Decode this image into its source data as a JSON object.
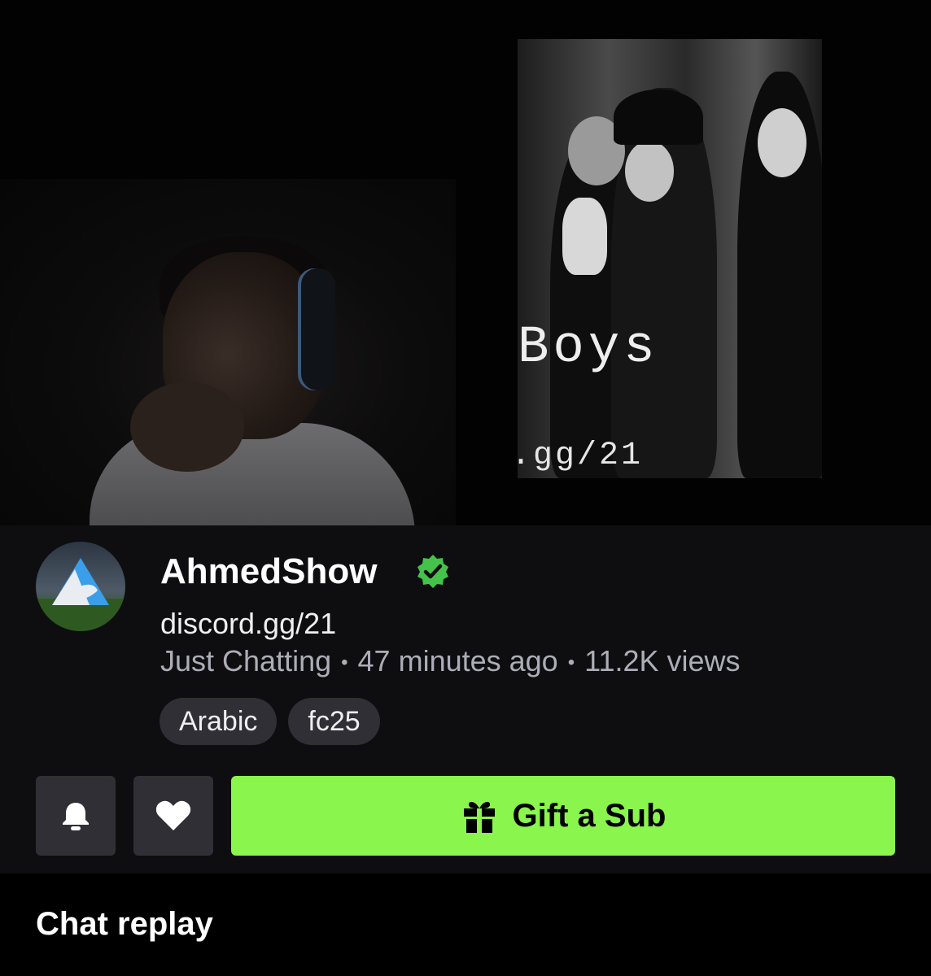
{
  "video": {
    "overlay_title": "Boys",
    "overlay_link": ".gg/21"
  },
  "channel": {
    "name": "AhmedShow",
    "verified_icon": "verified-badge-icon",
    "stream_title": "discord.gg/21",
    "category": "Just Chatting",
    "time_ago": "47 minutes ago",
    "views": "11.2K views",
    "separator": "•",
    "tags": [
      "Arabic",
      "fc25"
    ]
  },
  "actions": {
    "bell_icon": "bell-icon",
    "heart_icon": "heart-icon",
    "gift_label": "Gift a Sub",
    "gift_icon": "gift-icon"
  },
  "chat": {
    "title": "Chat replay"
  },
  "colors": {
    "accent_green": "#8af54d",
    "verified_green": "#45c24a",
    "background": "#0e0e10",
    "button_gray": "#2f2f35",
    "muted_text": "#adadb8"
  }
}
